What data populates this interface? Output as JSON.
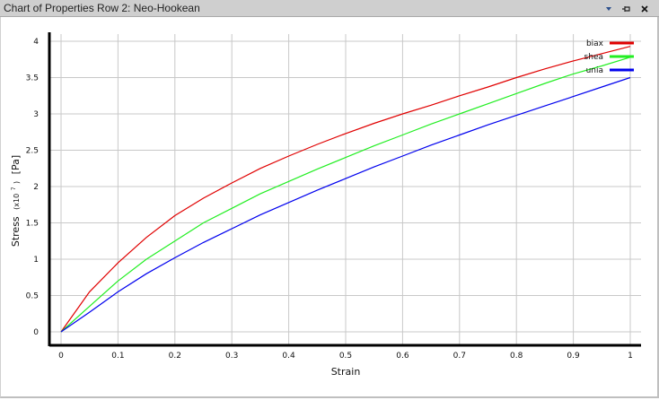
{
  "window": {
    "title": "Chart of Properties Row 2: Neo-Hookean",
    "controls": {
      "dropdown_icon": "chevron-down-icon",
      "pin_icon": "pin-icon",
      "close_icon": "close-icon"
    }
  },
  "chart_data": {
    "type": "line",
    "xlabel": "Strain",
    "ylabel_main": "Stress",
    "ylabel_scale_prefix": "(x10",
    "ylabel_scale_exp": "7",
    "ylabel_scale_suffix": ")",
    "ylabel_unit": "[Pa]",
    "xlim": [
      0,
      1
    ],
    "ylim": [
      0,
      4
    ],
    "x_ticks": [
      0,
      0.1,
      0.2,
      0.3,
      0.4,
      0.5,
      0.6,
      0.7,
      0.8,
      0.9,
      1
    ],
    "x_tick_labels": [
      "0",
      "0.1",
      "0.2",
      "0.3",
      "0.4",
      "0.5",
      "0.6",
      "0.7",
      "0.8",
      "0.9",
      "1"
    ],
    "y_ticks": [
      0,
      0.5,
      1,
      1.5,
      2,
      2.5,
      3,
      3.5,
      4
    ],
    "y_tick_labels": [
      "0",
      "0.5",
      "1",
      "1.5",
      "2",
      "2.5",
      "3",
      "3.5",
      "4"
    ],
    "grid": true,
    "legend_position": "top-right",
    "x": [
      0,
      0.05,
      0.1,
      0.15,
      0.2,
      0.25,
      0.3,
      0.35,
      0.4,
      0.45,
      0.5,
      0.55,
      0.6,
      0.65,
      0.7,
      0.75,
      0.8,
      0.85,
      0.9,
      0.95,
      1.0
    ],
    "series": [
      {
        "name": "biax",
        "color": "#e00000",
        "values": [
          0,
          0.55,
          0.95,
          1.3,
          1.6,
          1.84,
          2.05,
          2.25,
          2.42,
          2.58,
          2.73,
          2.87,
          3.0,
          3.12,
          3.25,
          3.37,
          3.5,
          3.62,
          3.73,
          3.83,
          3.93
        ]
      },
      {
        "name": "shea",
        "color": "#22ee22",
        "values": [
          0,
          0.35,
          0.7,
          1.0,
          1.25,
          1.5,
          1.7,
          1.9,
          2.07,
          2.24,
          2.4,
          2.56,
          2.71,
          2.86,
          3.0,
          3.14,
          3.28,
          3.42,
          3.55,
          3.66,
          3.78
        ]
      },
      {
        "name": "unia",
        "color": "#0000ee",
        "values": [
          0,
          0.27,
          0.55,
          0.8,
          1.02,
          1.23,
          1.42,
          1.61,
          1.78,
          1.95,
          2.11,
          2.27,
          2.42,
          2.57,
          2.71,
          2.85,
          2.98,
          3.11,
          3.24,
          3.37,
          3.5
        ]
      }
    ]
  }
}
